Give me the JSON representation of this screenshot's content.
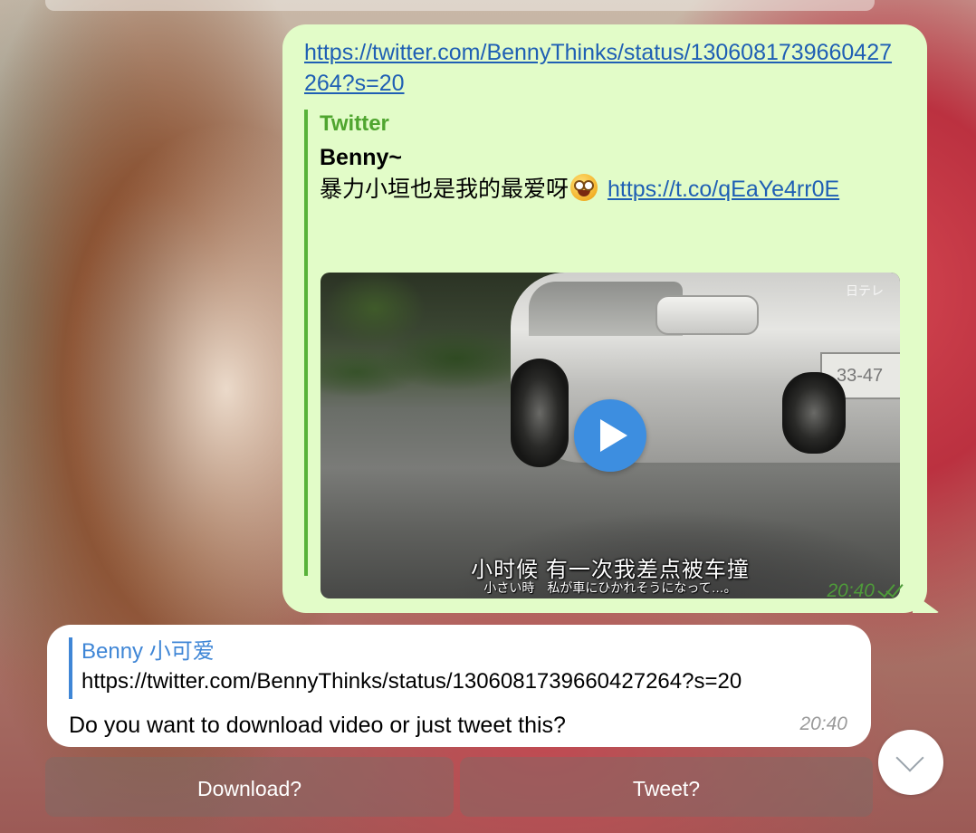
{
  "outgoing_message": {
    "link_text": "https://twitter.com/BennyThinks/status/1306081739660427264?s=20",
    "preview": {
      "site_name": "Twitter",
      "title": "Benny~",
      "description": "暴力小垣也是我的最爱呀",
      "emoji": "star-struck-emoji",
      "short_link": "https://t.co/qEaYe4rr0E",
      "video": {
        "subtitle_main": "小时候 有一次我差点被车撞",
        "subtitle_small": "小さい時　私が車にひかれそうになって…。",
        "watermark": "日テレ",
        "plate_text": "33-47",
        "play_icon": "play-icon"
      }
    },
    "time": "20:40",
    "status_icon": "double-check-icon",
    "colors": {
      "bubble": "#e2fcc8",
      "site_name": "#4fa52f",
      "link": "#1f5fb4"
    }
  },
  "incoming_message": {
    "reply_to": {
      "name": "Benny 小可爱",
      "text": "https://twitter.com/BennyThinks/status/1306081739660427264?s=20"
    },
    "text": "Do you want to download video or just tweet this?",
    "time": "20:40",
    "colors": {
      "reply_accent": "#3f86d6"
    }
  },
  "inline_keyboard": {
    "buttons": [
      {
        "label": "Download?"
      },
      {
        "label": "Tweet?"
      }
    ]
  },
  "scroll_down_button": {
    "icon": "chevron-down-icon"
  }
}
